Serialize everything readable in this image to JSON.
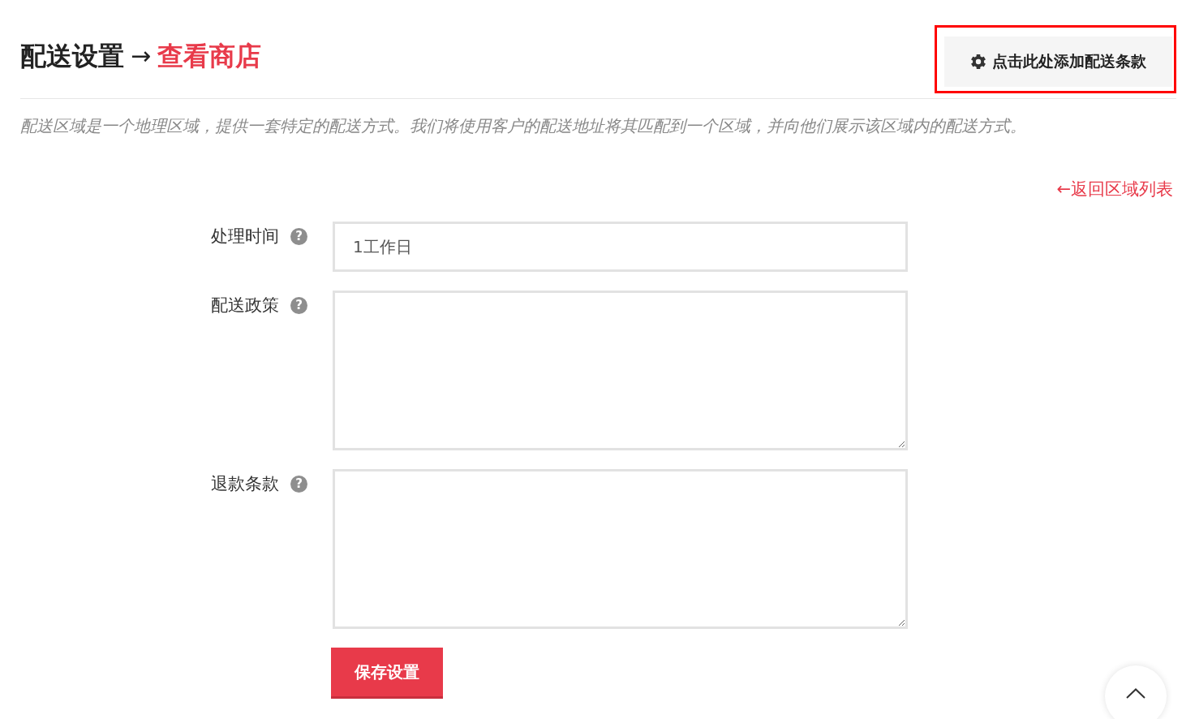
{
  "header": {
    "title": "配送设置",
    "separator": "→",
    "store_link": "查看商店",
    "button": {
      "label": "点击此处添加配送条款",
      "highlighted": true
    }
  },
  "description": "配送区域是一个地理区域，提供一套特定的配送方式。我们将使用客户的配送地址将其匹配到一个区域，并向他们展示该区域内的配送方式。",
  "back_link": "←返回区域列表",
  "fields": [
    {
      "label": "处理时间",
      "help": "?",
      "kind": "input",
      "value": "1工作日"
    },
    {
      "label": "配送政策",
      "help": "?",
      "kind": "textarea"
    },
    {
      "label": "退款条款",
      "help": "?",
      "kind": "textarea"
    }
  ],
  "save_button": "保存设置"
}
